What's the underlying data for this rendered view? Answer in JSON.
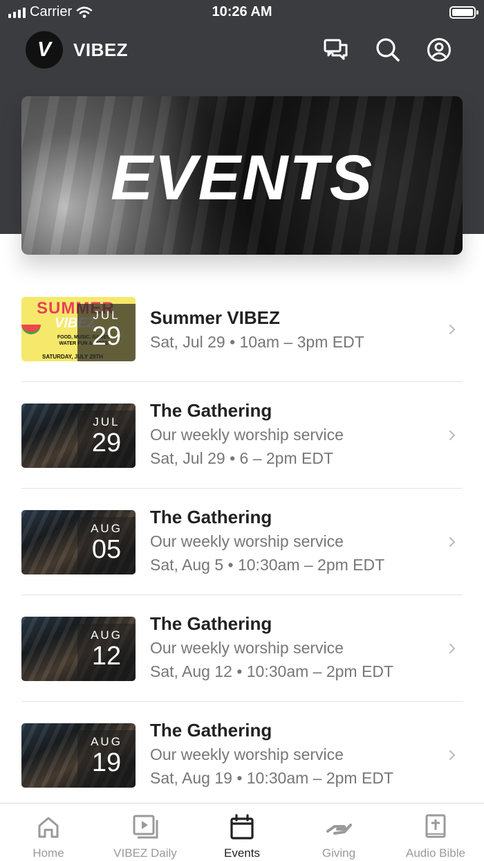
{
  "status_bar": {
    "carrier": "Carrier",
    "time": "10:26 AM"
  },
  "app": {
    "logo_letter": "V",
    "name": "VIBEZ"
  },
  "header_icons": [
    "chat-icon",
    "search-icon",
    "profile-icon"
  ],
  "hero": {
    "title": "EVENTS"
  },
  "events": [
    {
      "title": "Summer VIBEZ",
      "subtitle": "",
      "when": "Sat, Jul 29 • 10am – 3pm EDT",
      "month": "JUL",
      "day": "29",
      "thumb": {
        "style": "summer",
        "title": "SUMMER",
        "sub": "VIBEZ",
        "info": "FOOD, MUSIC, GAMES WATER FUN & MORE",
        "date": "SATURDAY, JULY 29TH"
      }
    },
    {
      "title": "The Gathering",
      "subtitle": "Our weekly worship service",
      "when": "Sat, Jul 29 • 6 – 2pm EDT",
      "month": "JUL",
      "day": "29",
      "thumb": {
        "style": "photo"
      }
    },
    {
      "title": "The Gathering",
      "subtitle": "Our weekly worship service",
      "when": "Sat, Aug 5 • 10:30am – 2pm EDT",
      "month": "AUG",
      "day": "05",
      "thumb": {
        "style": "photo"
      }
    },
    {
      "title": "The Gathering",
      "subtitle": "Our weekly worship service",
      "when": "Sat, Aug 12 • 10:30am – 2pm EDT",
      "month": "AUG",
      "day": "12",
      "thumb": {
        "style": "photo"
      }
    },
    {
      "title": "The Gathering",
      "subtitle": "Our weekly worship service",
      "when": "Sat, Aug 19 • 10:30am – 2pm EDT",
      "month": "AUG",
      "day": "19",
      "thumb": {
        "style": "photo"
      }
    }
  ],
  "tabs": [
    {
      "label": "Home",
      "icon": "home-icon",
      "active": false
    },
    {
      "label": "VIBEZ Daily",
      "icon": "video-icon",
      "active": false
    },
    {
      "label": "Events",
      "icon": "calendar-icon",
      "active": true
    },
    {
      "label": "Giving",
      "icon": "giving-hand-icon",
      "active": false
    },
    {
      "label": "Audio Bible",
      "icon": "bible-icon",
      "active": false
    }
  ],
  "colors": {
    "header_bg": "#3b3c3f",
    "active_tab": "#222222",
    "inactive_tab": "#9a9a9a"
  }
}
